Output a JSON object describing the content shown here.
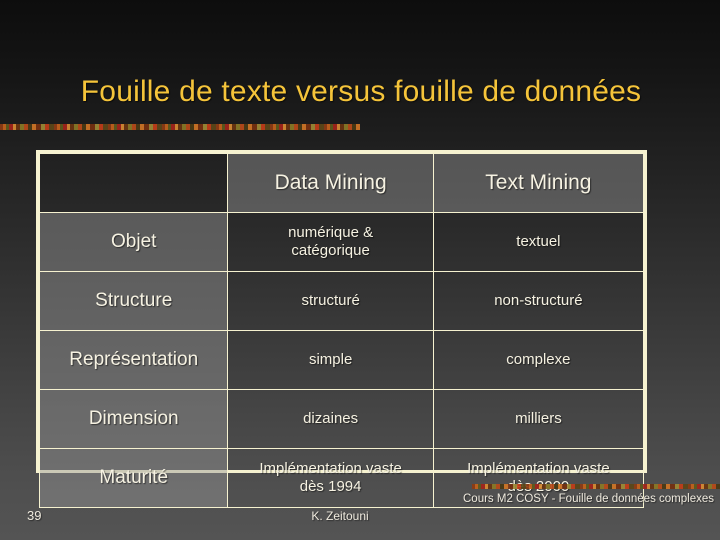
{
  "slide": {
    "title": "Fouille de texte versus fouille de données"
  },
  "table": {
    "corner_label": "",
    "columns": [
      "",
      "Data Mining",
      "Text Mining"
    ],
    "rows": [
      {
        "label": "Objet",
        "data_mining": "numérique &\ncatégorique",
        "text_mining": "textuel"
      },
      {
        "label": "Structure",
        "data_mining": "structuré",
        "text_mining": "non-structuré"
      },
      {
        "label": "Représentation",
        "data_mining": "simple",
        "text_mining": "complexe"
      },
      {
        "label": "Dimension",
        "data_mining": "dizaines",
        "text_mining": "milliers"
      },
      {
        "label": "Maturité",
        "data_mining": "Implémentation vaste\ndès 1994",
        "text_mining": "Implémentation vaste\ndès 2000"
      }
    ]
  },
  "footer": {
    "slide_number": "39",
    "author": "K. Zeitouni",
    "course": "Cours M2 COSY -  Fouille de données complexes"
  },
  "colors": {
    "title": "#f5c43a",
    "border": "#f6f2d0",
    "text": "#f6f2e2",
    "cell_gray": "rgba(150,150,150,0.45)"
  }
}
